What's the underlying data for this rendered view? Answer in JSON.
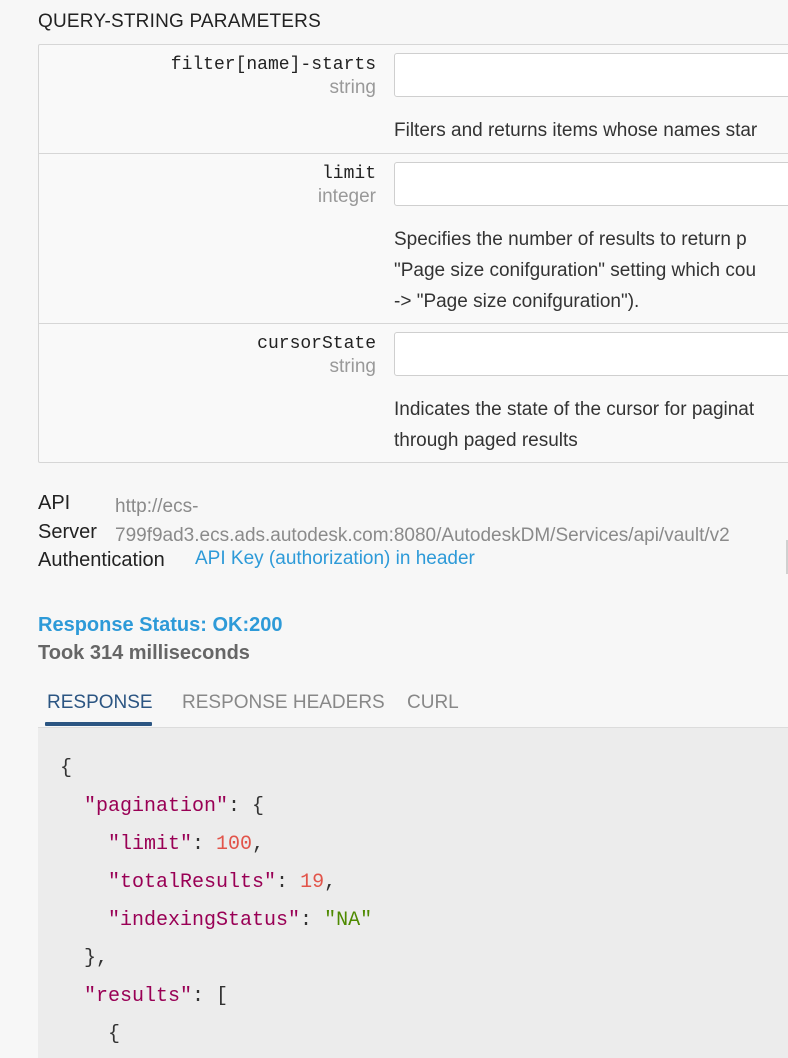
{
  "query_params": {
    "title": "QUERY-STRING PARAMETERS",
    "params": [
      {
        "name": "filter[name]-starts",
        "type": "string",
        "value": "",
        "description": "Filters and returns items whose names star"
      },
      {
        "name": "limit",
        "type": "integer",
        "value": "",
        "description": "Specifies the number of results to return p\n\"Page size conifguration\" setting which cou\n-> \"Page size conifguration\")."
      },
      {
        "name": "cursorState",
        "type": "string",
        "value": "",
        "description": "Indicates the state of the cursor for paginat\nthrough paged results"
      }
    ]
  },
  "server": {
    "label_api": "API",
    "label_server": "Server",
    "url": "http://ecs-\n799f9ad3.ecs.ads.autodesk.com:8080/AutodeskDM/Services/api/vault/v2",
    "auth_label": "Authentication",
    "auth_value": "API Key (authorization) in header"
  },
  "response": {
    "status": "Response Status: OK:200",
    "took": "Took 314 milliseconds",
    "tabs": [
      "RESPONSE",
      "RESPONSE HEADERS",
      "CURL"
    ],
    "active_tab": "RESPONSE",
    "code": {
      "l1": "{",
      "pagination_key": "\"pagination\"",
      "l2_suffix": ": {",
      "limit_key": "\"limit\"",
      "limit_val": "100",
      "total_key": "\"totalResults\"",
      "total_val": "19",
      "indexing_key": "\"indexingStatus\"",
      "indexing_val": "\"NA\"",
      "close_obj": "},",
      "results_key": "\"results\"",
      "results_suffix": ": [",
      "open_item": "{"
    }
  },
  "colors": {
    "accent_link": "#2d9ad8",
    "tab_active": "#2b5582",
    "json_key": "#990055",
    "json_number": "#e2544a",
    "json_string": "#4e8a00"
  }
}
